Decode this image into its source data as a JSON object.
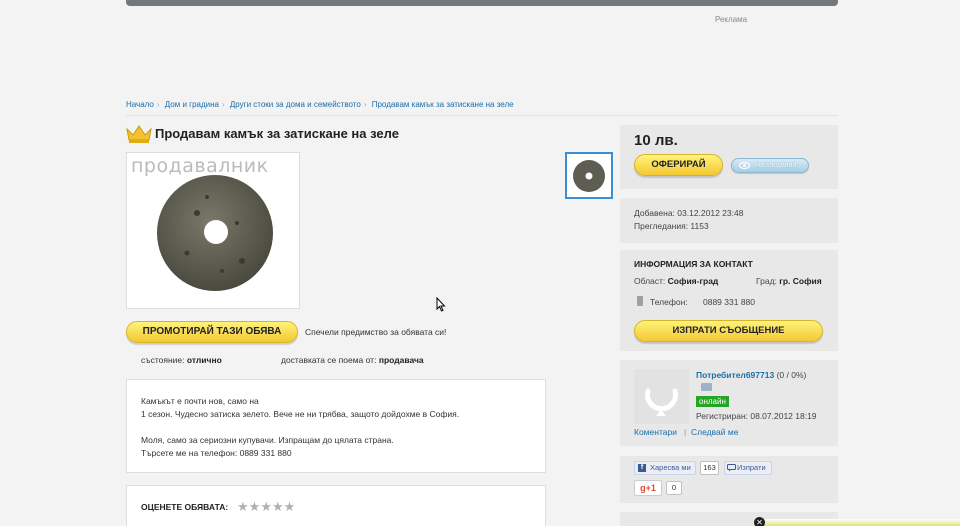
{
  "ad": {
    "label": "Реклама"
  },
  "breadcrumb": {
    "items": [
      "Начало",
      "Дом и градина",
      "Други стоки за дома и семейството",
      "Продавам камък за затискане на зеле"
    ]
  },
  "listing": {
    "title": "Продавам камък за затискане на зеле",
    "watermark": "продавалник",
    "promote_label": "ПРОМОТИРАЙ ТАЗИ ОБЯВА",
    "promote_hint": "Спечели предимство за обявата си!",
    "condition_label": "състояние:",
    "condition_value": "отлично",
    "delivery_label": "доставката се поема от:",
    "delivery_value": "продавача",
    "description": [
      "Камъкът е почти нов, само на",
      "1 сезон. Чудесно затиска зелето. Вече не ни трябва, защото дойдохме в София.",
      "",
      "Моля, само за сериозни купувачи. Изпращам до цялата страна.",
      "Търсете ме на телефон: 0889 331 880"
    ],
    "rate_label": "ОЦЕНЕТЕ ОБЯВАТА:",
    "rating_max": 5
  },
  "price_panel": {
    "price": "10 лв.",
    "offer_label": "ОФЕРИРАЙ",
    "watch_label": "Наблюдавай"
  },
  "stats": {
    "added": "Добавена: 03.12.2012 23:48",
    "views": "Прегледания: 1153"
  },
  "contact": {
    "title": "ИНФОРМАЦИЯ ЗА КОНТАКТ",
    "region_label": "Област:",
    "region_value": "София-град",
    "city_label": "Град:",
    "city_value": "гр. София",
    "phone_label": "Телефон:",
    "phone_value": "0889 331 880",
    "send_label": "ИЗПРАТИ СЪОБЩЕНИЕ"
  },
  "seller": {
    "username": "Потребител697713",
    "score": "(0 / 0%)",
    "status": "онлайн",
    "registered": "Регистриран: 08.07.2012 18:19",
    "comments_link": "Коментари",
    "follow_link": "Следвай ме"
  },
  "social": {
    "like_label": "Харесва ми",
    "like_count": "163",
    "share_label": "Изпрати",
    "gplus_label": "+1",
    "gplus_count": "0"
  },
  "colors": {
    "accent_yellow": "#f3c934",
    "link_blue": "#1b6fa8",
    "online_green": "#24a524"
  }
}
